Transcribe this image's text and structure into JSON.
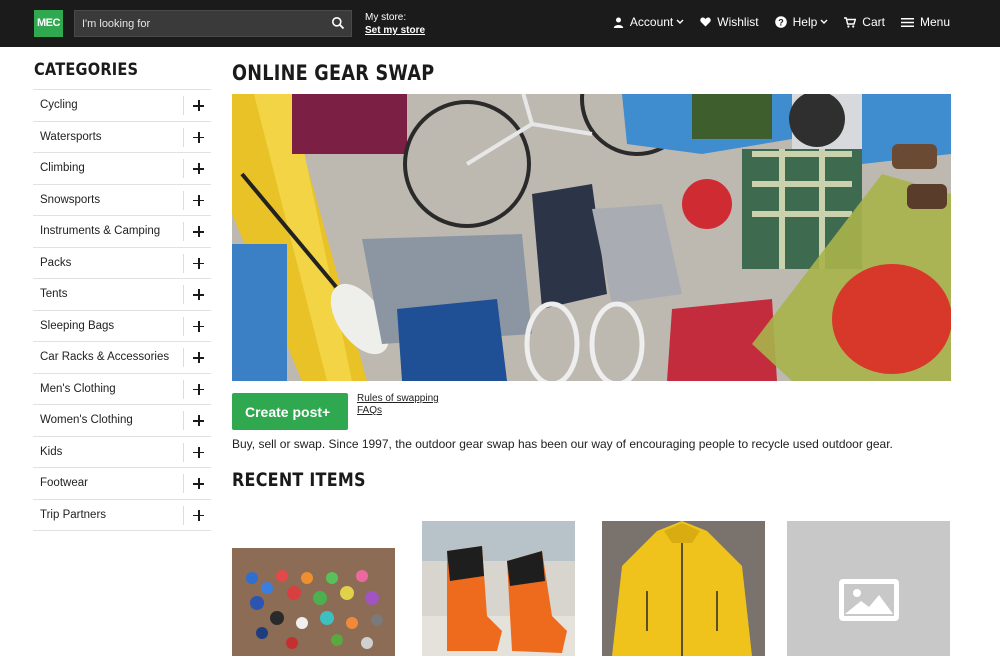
{
  "header": {
    "logo_text": "MEC",
    "search_placeholder": "I'm looking for",
    "store_label": "My store:",
    "store_link": "Set my store",
    "nav": {
      "account": "Account",
      "wishlist": "Wishlist",
      "help": "Help",
      "cart": "Cart",
      "menu": "Menu"
    }
  },
  "sidebar": {
    "title": "CATEGORIES",
    "items": [
      "Cycling",
      "Watersports",
      "Climbing",
      "Snowsports",
      "Instruments & Camping",
      "Packs",
      "Tents",
      "Sleeping Bags",
      "Car Racks & Accessories",
      "Men's Clothing",
      "Women's Clothing",
      "Kids",
      "Footwear",
      "Trip Partners"
    ]
  },
  "main": {
    "title": "ONLINE GEAR SWAP",
    "create_button": "Create post+",
    "rules_link": "Rules of swapping",
    "faq_link": "FAQs",
    "intro": "Buy, sell or swap. Since 1997, the outdoor gear swap has been our way of encouraging people to recycle used outdoor gear.",
    "recent_title": "RECENT ITEMS"
  },
  "colors": {
    "header_bg": "#1b1b1b",
    "brand_green": "#2fa84f"
  }
}
